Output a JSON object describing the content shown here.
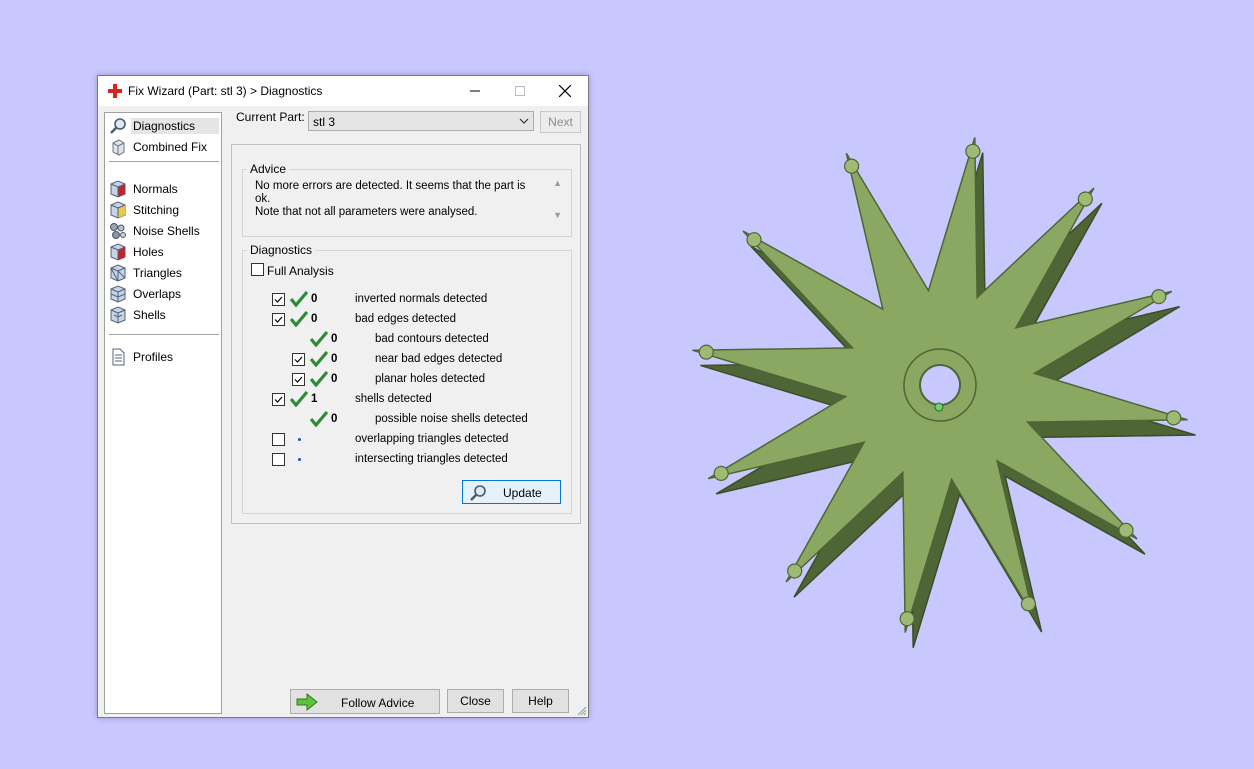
{
  "window": {
    "title": "Fix Wizard (Part: stl 3) > Diagnostics"
  },
  "sidebar": {
    "items": [
      {
        "label": "Diagnostics",
        "icon": "magnifier-icon"
      },
      {
        "label": "Combined Fix",
        "icon": "cube-icon"
      },
      {
        "label": "Normals",
        "icon": "cube-red-face-icon"
      },
      {
        "label": "Stitching",
        "icon": "cube-yellow-face-icon"
      },
      {
        "label": "Noise Shells",
        "icon": "noise-shells-icon"
      },
      {
        "label": "Holes",
        "icon": "cube-red-face-icon"
      },
      {
        "label": "Triangles",
        "icon": "triangles-icon"
      },
      {
        "label": "Overlaps",
        "icon": "overlaps-icon"
      },
      {
        "label": "Shells",
        "icon": "shells-icon"
      },
      {
        "label": "Profiles",
        "icon": "document-icon"
      }
    ],
    "active": "Diagnostics"
  },
  "current_part": {
    "label": "Current Part:",
    "value": "stl 3",
    "next_label": "Next"
  },
  "advice": {
    "legend": "Advice",
    "line1": "No more errors are detected. It seems that the part is ok.",
    "line2": "Note that not all parameters were analysed."
  },
  "diagnostics": {
    "legend": "Diagnostics",
    "full_analysis": {
      "label": "Full Analysis",
      "checked": false
    },
    "rows": [
      {
        "checked": true,
        "status": "ok",
        "count": "0",
        "label": "inverted normals detected"
      },
      {
        "checked": true,
        "status": "ok",
        "count": "0",
        "label": "bad edges detected"
      },
      {
        "status": "ok",
        "count": "0",
        "label": "bad contours detected"
      },
      {
        "checked": true,
        "status": "ok",
        "count": "0",
        "label": "near bad edges detected"
      },
      {
        "checked": true,
        "status": "ok",
        "count": "0",
        "label": "planar holes detected"
      },
      {
        "checked": true,
        "status": "ok",
        "count": "1",
        "label": "shells detected"
      },
      {
        "status": "ok",
        "count": "0",
        "label": "possible noise shells detected"
      },
      {
        "checked": false,
        "status": "pending",
        "count": "",
        "label": "overlapping triangles detected"
      },
      {
        "checked": false,
        "status": "pending",
        "count": "",
        "label": "intersecting triangles detected"
      }
    ],
    "update_label": "Update"
  },
  "footer": {
    "follow_advice_label": "Follow Advice",
    "close_label": "Close",
    "help_label": "Help"
  },
  "colors": {
    "viewport_bg": "#c8c8ff",
    "model_fill": "#7d9a5a",
    "check_green": "#2e8b3a",
    "accent_blue": "#0078d7"
  }
}
